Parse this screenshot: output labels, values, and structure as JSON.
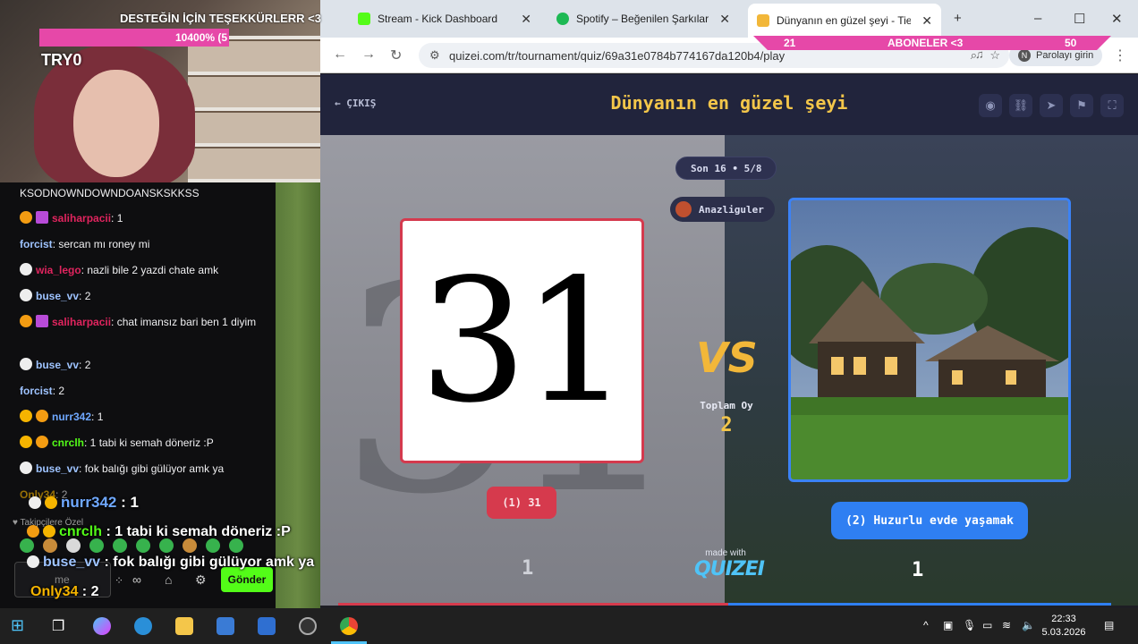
{
  "browser": {
    "tabs": [
      {
        "label": "Stream - Kick Dashboard",
        "favicon_color": "#53fc18"
      },
      {
        "label": "Spotify – Beğenilen Şarkılar",
        "favicon_color": "#1db954"
      },
      {
        "label": "Dünyanın en güzel şeyi - Tier Li",
        "favicon_color": "#f2b739"
      }
    ],
    "url": "quizei.com/tr/tournament/quiz/69a31e0784b774167da120b4/play",
    "password_chip": "Parolayı girin",
    "password_initial": "N"
  },
  "quiz": {
    "exit_label": "ÇIKIŞ",
    "title": "Dünyanın en güzel şeyi",
    "round": "Son 16 • 5/8",
    "author": "Anazliguler",
    "left_card_text": "31",
    "vs": "VS",
    "total_votes_label": "Toplam Oy",
    "total_votes": "2",
    "left_option": "(1) 31",
    "right_option": "(2) Huzurlu evde yaşamak",
    "left_count": "1",
    "right_count": "1",
    "made_with": "made with",
    "brand": "QUIZEI",
    "accent_red": "#d63a4d",
    "accent_blue": "#2f7ff2",
    "accent_gold": "#f3c64a"
  },
  "overlay": {
    "donation_thanks": "DESTEĞİN İÇİN TEŞEKKÜRLERR <3",
    "donation_progress": "10400% (5",
    "streamer": "TRY0",
    "sub_left": "21",
    "sub_label": "ABONELER <3",
    "sub_right": "50"
  },
  "chat": {
    "lines": [
      {
        "user": "",
        "text": "KSODNOWNDOWNDOANSKSKKSS",
        "color": "#efeff1",
        "badge": ""
      },
      {
        "user": "saliharpacii",
        "text": ": 1",
        "color": "#e0245e",
        "badge": "#f39c12"
      },
      {
        "user": "forcist",
        "text": ": sercan mı roney mi",
        "color": "#9ec3ff",
        "badge": ""
      },
      {
        "user": "wia_lego",
        "text": ": nazli bile 2 yazdi chate amk",
        "color": "#e0245e",
        "badge": "#eee"
      },
      {
        "user": "buse_vv",
        "text": ": 2",
        "color": "#9ec3ff",
        "badge": "#eee"
      },
      {
        "user": "saliharpacii",
        "text": ": chat imansız bari ben 1 diyim",
        "color": "#e0245e",
        "badge": "#f39c12"
      },
      {
        "user": "buse_vv",
        "text": ": 2",
        "color": "#9ec3ff",
        "badge": "#eee"
      },
      {
        "user": "forcist",
        "text": ": 2",
        "color": "#9ec3ff",
        "badge": ""
      },
      {
        "user": "nurr342",
        "text": ": 1",
        "color": "#6fa8ff",
        "badge": "#f5b400"
      },
      {
        "user": "cnrclh",
        "text": ": 1 tabi ki semah döneriz :P",
        "color": "#53fc18",
        "badge": "#f5b400"
      },
      {
        "user": "buse_vv",
        "text": ": fok balığı gibi gülüyor amk ya",
        "color": "#9ec3ff",
        "badge": "#eee"
      },
      {
        "user": "Only34",
        "text": ": 2",
        "color": "#f5b400",
        "badge": ""
      }
    ],
    "big_lines": [
      {
        "user": "nurr342",
        "text": " : 1",
        "color": "#6fa8ff"
      },
      {
        "user": "cnrclh",
        "text": " : 1 tabi ki semah döneriz :P",
        "color": "#53fc18"
      },
      {
        "user": "buse_vv",
        "text": " : fok balığı gibi gülüyor amk ya",
        "color": "#9ec3ff"
      },
      {
        "user": "Only34",
        "text": " : 2",
        "color": "#f5b400"
      }
    ],
    "followers_only": "Takipçilere Özel",
    "input_placeholder": "me",
    "send_label": "Gönder"
  },
  "taskbar": {
    "time": "22:33",
    "date": "5.03.2026"
  }
}
